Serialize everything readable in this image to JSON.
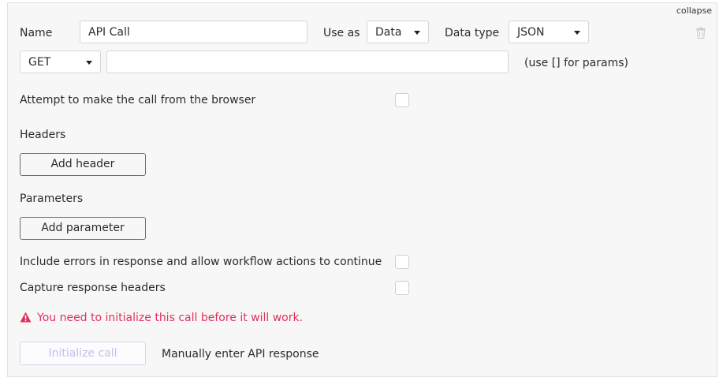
{
  "panel": {
    "collapse_label": "collapse"
  },
  "row1": {
    "name_label": "Name",
    "name_value": "API Call",
    "use_as_label": "Use as",
    "use_as_value": "Data",
    "data_type_label": "Data type",
    "data_type_value": "JSON"
  },
  "row2": {
    "method_value": "GET",
    "url_value": "",
    "hint": "(use [] for params)"
  },
  "browser_call": {
    "label": "Attempt to make the call from the browser",
    "checked": false
  },
  "headers": {
    "title": "Headers",
    "add_button": "Add header"
  },
  "parameters": {
    "title": "Parameters",
    "add_button": "Add parameter"
  },
  "include_errors": {
    "label": "Include errors in response and allow workflow actions to continue",
    "checked": false
  },
  "capture_headers": {
    "label": "Capture response headers",
    "checked": false
  },
  "warning": {
    "text": "You need to initialize this call before it will work.",
    "icon": "warning-triangle-icon",
    "color": "#e0305c"
  },
  "footer": {
    "initialize_button": "Initialize call",
    "manual_link": "Manually enter API response"
  },
  "icons": {
    "trash": "trash-icon",
    "dropdown": "chevron-down-icon"
  }
}
